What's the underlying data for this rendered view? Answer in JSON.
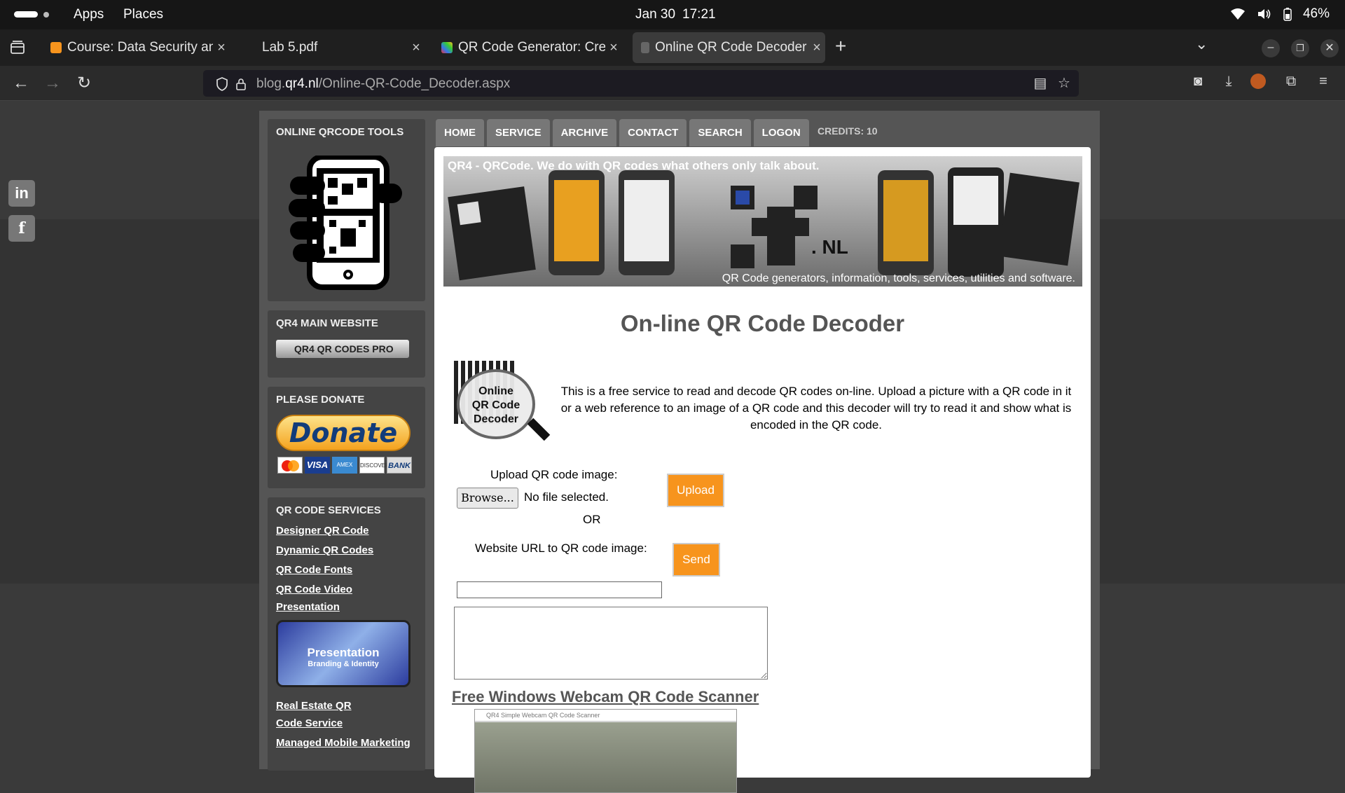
{
  "system": {
    "apps": "Apps",
    "places": "Places",
    "date": "Jan 30",
    "time": "17:21",
    "battery": "46%"
  },
  "tabs": [
    {
      "title": "Course: Data Security and",
      "active": false
    },
    {
      "title": "Lab 5.pdf",
      "active": false
    },
    {
      "title": "QR Code Generator: Creat",
      "active": false
    },
    {
      "title": "Online QR Code Decoder",
      "active": true
    }
  ],
  "address": {
    "domain_pre": "blog.",
    "domain": "qr4.nl",
    "path": "/Online-QR-Code_Decoder.aspx"
  },
  "site": {
    "sidebar": {
      "tools_title": "ONLINE QRCODE TOOLS",
      "main_title": "QR4 MAIN WEBSITE",
      "main_logo_text": "QR4 QR CODES PRO",
      "donate_title": "PLEASE DONATE",
      "donate_label": "Donate",
      "services_title": "QR CODE SERVICES",
      "links": [
        "Designer QR Code",
        "Dynamic QR Codes",
        "QR Code Fonts",
        "QR Code Video Presentation",
        "Real Estate QR Code Service",
        "Managed Mobile Marketing"
      ],
      "promo_title": "Presentation",
      "promo_sub": "Branding & Identity"
    },
    "nav": [
      "HOME",
      "SERVICE",
      "ARCHIVE",
      "CONTACT",
      "SEARCH",
      "LOGON"
    ],
    "credits": "CREDITS: 10",
    "banner": {
      "tagline": "QR4 - QRCode. We do with QR codes what others only talk about.",
      "subtitle": "QR Code generators, information, tools, services, utilities and software.",
      "brand": ". NL"
    },
    "heading": "On-line QR Code Decoder",
    "decoder_logo": [
      "Online",
      "QR Code",
      "Decoder"
    ],
    "intro": "This is a free service to read and decode QR codes on-line. Upload a picture with a QR code in it or a web reference to an image of a QR code and this decoder will try to read it and show what is encoded in the QR code.",
    "upload_label": "Upload QR code image:",
    "browse": "Browse...",
    "no_file": "No file selected.",
    "upload_btn": "Upload",
    "or": "OR",
    "url_label": "Website URL to QR code image:",
    "url_value": "",
    "send_btn": "Send",
    "result_text": "",
    "webcam_link": "Free Windows Webcam QR Code Scanner",
    "webcam_window_title": "QR4 Simple Webcam QR Code Scanner"
  },
  "colors": {
    "accent": "#f7941d",
    "site_bg": "#555555",
    "nav_bg": "#777777"
  }
}
